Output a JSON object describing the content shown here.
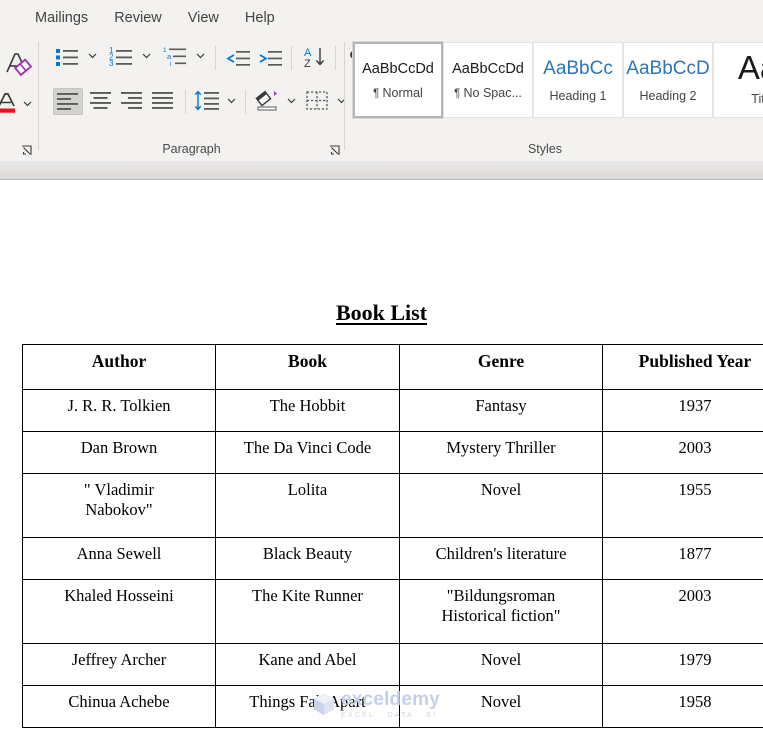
{
  "ribbon": {
    "tabs": [
      {
        "label": "Mailings",
        "active": false
      },
      {
        "label": "Review",
        "active": false
      },
      {
        "label": "View",
        "active": false
      },
      {
        "label": "Help",
        "active": false
      }
    ],
    "font_group": {
      "clear_formatting_icon": "clear-formatting-icon",
      "font_color_icon": "font-color-icon",
      "launcher_icon": "dialog-launcher-icon"
    },
    "paragraph_group": {
      "label": "Paragraph",
      "launcher_icon": "dialog-launcher-icon",
      "row1": [
        {
          "name": "bullets",
          "icon": "bullet-list-icon",
          "dropdown": true
        },
        {
          "name": "numbering",
          "icon": "numbered-list-icon",
          "dropdown": true
        },
        {
          "name": "multilevel-list",
          "icon": "multilevel-list-icon",
          "dropdown": true
        },
        {
          "name": "decrease-indent",
          "icon": "decrease-indent-icon",
          "dropdown": false
        },
        {
          "name": "increase-indent",
          "icon": "increase-indent-icon",
          "dropdown": false
        },
        {
          "name": "sort",
          "icon": "sort-az-icon",
          "dropdown": false
        },
        {
          "name": "show-hide-marks",
          "icon": "pilcrow-icon",
          "dropdown": false
        }
      ],
      "row2": [
        {
          "name": "align-left",
          "icon": "align-left-icon",
          "selected": true,
          "dropdown": false
        },
        {
          "name": "align-center",
          "icon": "align-center-icon",
          "selected": false,
          "dropdown": false
        },
        {
          "name": "align-right",
          "icon": "align-right-icon",
          "selected": false,
          "dropdown": false
        },
        {
          "name": "justify",
          "icon": "justify-icon",
          "selected": false,
          "dropdown": false
        },
        {
          "name": "line-spacing",
          "icon": "line-spacing-icon",
          "selected": false,
          "dropdown": true
        },
        {
          "name": "shading",
          "icon": "shading-icon",
          "selected": false,
          "dropdown": true
        },
        {
          "name": "borders",
          "icon": "borders-icon",
          "selected": false,
          "dropdown": true
        }
      ]
    },
    "styles_group": {
      "label": "Styles",
      "items": [
        {
          "preview": "AaBbCcDd",
          "name": "Normal",
          "pilcrow": "¶ ",
          "kind": "normal",
          "selected": true
        },
        {
          "preview": "AaBbCcDd",
          "name": "No Spac...",
          "pilcrow": "¶ ",
          "kind": "normal",
          "selected": false
        },
        {
          "preview": "AaBbCc",
          "name": "Heading 1",
          "pilcrow": "",
          "kind": "heading",
          "selected": false
        },
        {
          "preview": "AaBbCcD",
          "name": "Heading 2",
          "pilcrow": "",
          "kind": "heading",
          "selected": false
        },
        {
          "preview": "Aa",
          "name": "Tit",
          "pilcrow": "",
          "kind": "title",
          "selected": false
        }
      ]
    }
  },
  "document": {
    "title": "Book List",
    "table": {
      "headers": [
        "Author",
        "Book",
        "Genre",
        "Published Year"
      ],
      "rows": [
        {
          "author": "J. R. R. Tolkien",
          "book": "The Hobbit",
          "genre": "Fantasy",
          "year": "1937",
          "tall": false
        },
        {
          "author": "Dan Brown",
          "book": "The Da Vinci Code",
          "genre": "Mystery Thriller",
          "year": "2003",
          "tall": false
        },
        {
          "author": "\"        Vladimir",
          "author_line2": "Nabokov\"",
          "book": "Lolita",
          "genre": "Novel",
          "year": "1955",
          "tall": true
        },
        {
          "author": "Anna Sewell",
          "book": "Black Beauty",
          "genre": "Children's literature",
          "year": "1877",
          "tall": false
        },
        {
          "author": "Khaled Hosseini",
          "book": "The Kite Runner",
          "genre": "\"Bildungsroman",
          "genre_line2": "Historical fiction\"",
          "year": "2003",
          "tall": true
        },
        {
          "author": "Jeffrey Archer",
          "book": "Kane and Abel",
          "genre": "Novel",
          "year": "1979",
          "tall": false
        },
        {
          "author": "Chinua Achebe",
          "book": "Things Fall Apart",
          "genre": "Novel",
          "year": "1958",
          "tall": false
        }
      ]
    }
  },
  "watermark": {
    "main": "exceldemy",
    "sub": "EXCEL · DATA · BI",
    "color": "#c5cfe8"
  }
}
